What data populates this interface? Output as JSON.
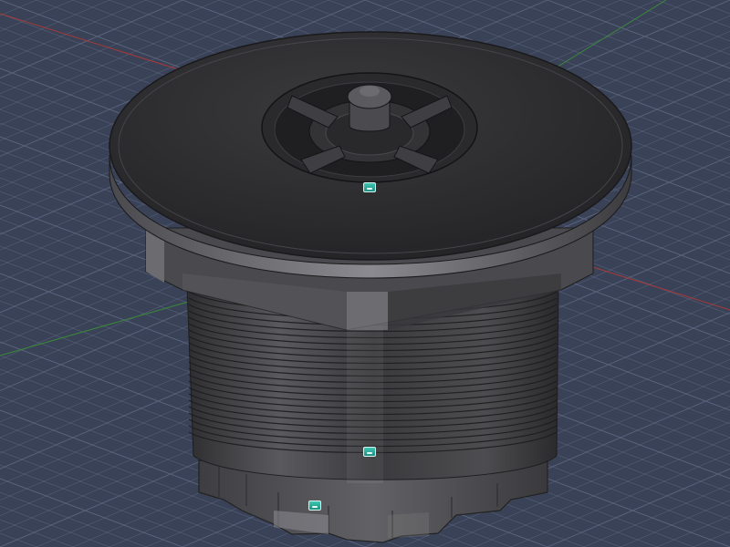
{
  "viewport": {
    "background": "#3a4257",
    "grid_color": "#5b6680",
    "axis_x_color": "#a53a3a",
    "axis_y_color": "#3a8a3a"
  },
  "model": {
    "body_color": "#2a2a2c",
    "highlight_color": "#6a6a6e"
  },
  "markers": [
    {
      "name": "cap-marker"
    },
    {
      "name": "thread-marker"
    },
    {
      "name": "nut-marker"
    }
  ]
}
